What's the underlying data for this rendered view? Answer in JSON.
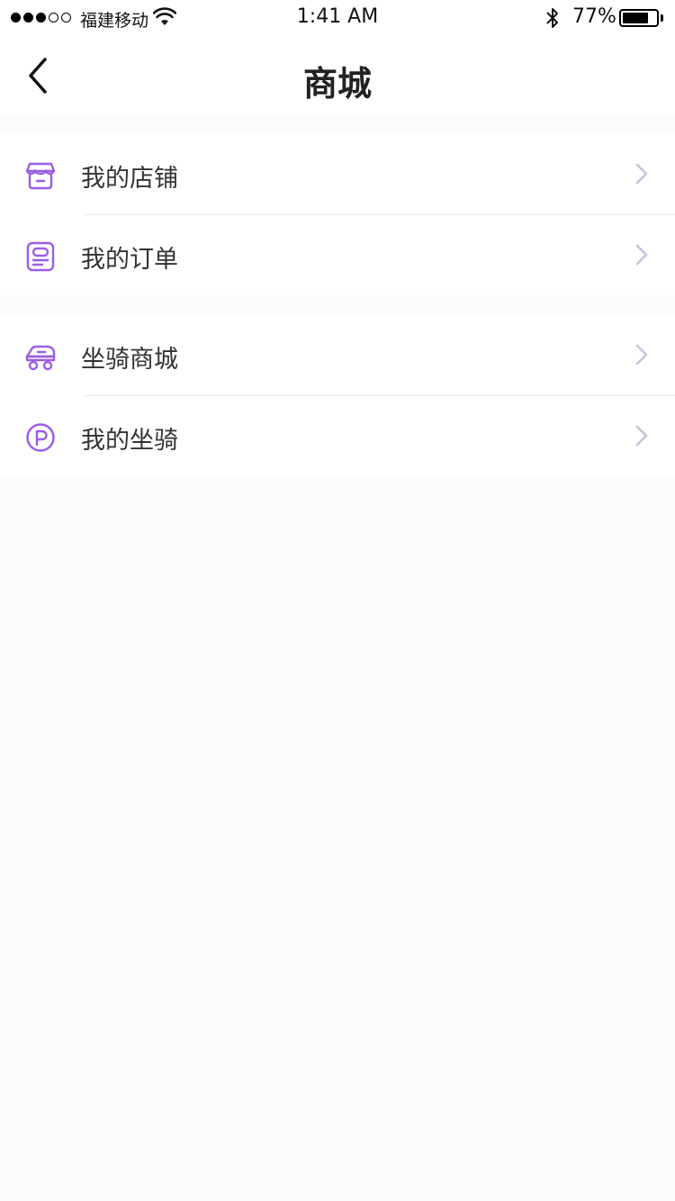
{
  "status_bar": {
    "carrier": "福建移动",
    "time": "1:41 AM",
    "battery_percent": "77%",
    "battery_level": 0.77,
    "signal_bars_filled": 3,
    "signal_bars_total": 5
  },
  "nav": {
    "title": "商城",
    "back_icon": "chevron-left-icon"
  },
  "groups": [
    {
      "items": [
        {
          "label": "我的店铺",
          "icon": "store-icon"
        },
        {
          "label": "我的订单",
          "icon": "order-icon"
        }
      ]
    },
    {
      "items": [
        {
          "label": "坐骑商城",
          "icon": "vehicle-icon"
        },
        {
          "label": "我的坐骑",
          "icon": "parking-icon"
        }
      ]
    }
  ],
  "colors": {
    "accent": "#9b5de5",
    "chevron": "#c7c2dd",
    "background": "#fbfbfd",
    "divider": "#ececf0"
  }
}
